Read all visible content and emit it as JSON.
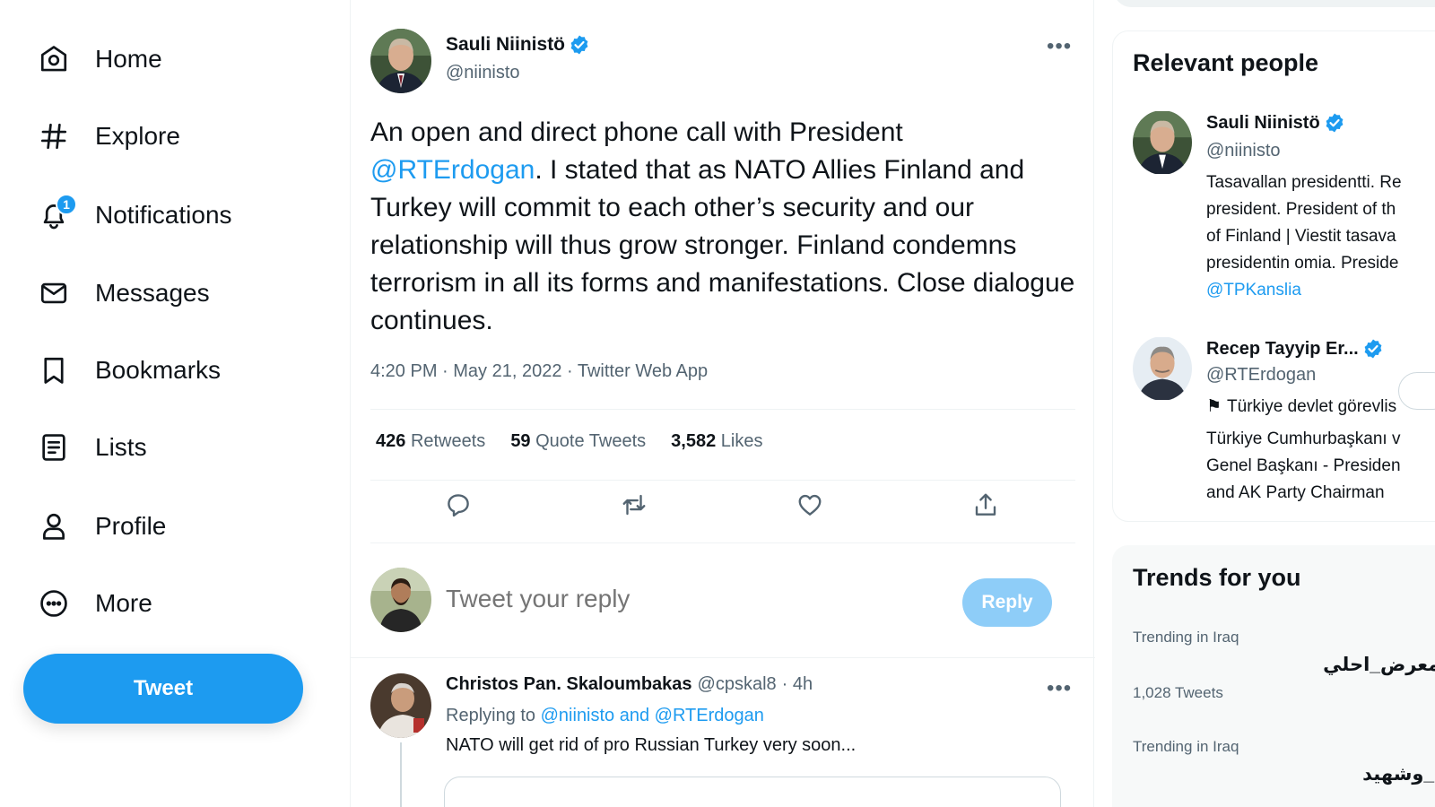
{
  "nav": {
    "items": [
      {
        "label": "Home",
        "icon": "home-icon"
      },
      {
        "label": "Explore",
        "icon": "hashtag-icon"
      },
      {
        "label": "Notifications",
        "icon": "bell-icon",
        "badge": "1"
      },
      {
        "label": "Messages",
        "icon": "mail-icon"
      },
      {
        "label": "Bookmarks",
        "icon": "bookmark-icon"
      },
      {
        "label": "Lists",
        "icon": "list-icon"
      },
      {
        "label": "Profile",
        "icon": "person-icon"
      },
      {
        "label": "More",
        "icon": "more-circle-icon"
      }
    ],
    "tweet_button": "Tweet"
  },
  "tweet": {
    "author_name": "Sauli Niinistö",
    "author_handle": "@niinisto",
    "text_before_mention": "An open and direct phone call with President ",
    "mention": "@RTErdogan",
    "text_after_mention": ". I stated that as NATO Allies Finland and Turkey will commit to each other’s security and our relationship will thus grow stronger. Finland condemns terrorism in all its forms and manifestations. Close dialogue continues.",
    "meta": "4:20 PM · May 21, 2022 · Twitter Web App",
    "stats": {
      "retweets_count": "426",
      "retweets_label": "Retweets",
      "quotes_count": "59",
      "quotes_label": "Quote Tweets",
      "likes_count": "3,582",
      "likes_label": "Likes"
    }
  },
  "reply_box": {
    "placeholder": "Tweet your reply",
    "button": "Reply"
  },
  "comment": {
    "name": "Christos Pan. Skaloumbakas",
    "handle": "@cpskal8",
    "time": "· 4h",
    "replying_prefix": "Replying to",
    "replying_to": "@niinisto and @RTErdogan",
    "text": "NATO will get rid of pro Russian Turkey very soon..."
  },
  "relevant_people": {
    "title": "Relevant people",
    "people": [
      {
        "name": "Sauli Niinistö",
        "handle": "@niinisto",
        "bio_lines": [
          "Tasavallan presidentti. Re",
          "president. President of th",
          "of Finland | Viestit tasava",
          "presidentin omia. Preside"
        ],
        "bio_link": "@TPKanslia"
      },
      {
        "name": "Recep Tayyip Er...",
        "handle": "@RTErdogan",
        "label": "Türkiye devlet görevlis",
        "bio_lines": [
          "Türkiye Cumhurbaşkanı v",
          "Genel Başkanı - Presiden",
          "and AK Party Chairman"
        ]
      }
    ]
  },
  "trends": {
    "title": "Trends for you",
    "items": [
      {
        "meta": "Trending in Iraq",
        "name": "_المعرض_احلي",
        "count": "1,028 Tweets"
      },
      {
        "meta": "Trending in Iraq",
        "name": "اهد_وشهيد"
      }
    ]
  },
  "colors": {
    "accent": "#1d9bf0",
    "text": "#0f1419",
    "muted": "#536471",
    "reply_disabled": "#8ecdf8"
  }
}
